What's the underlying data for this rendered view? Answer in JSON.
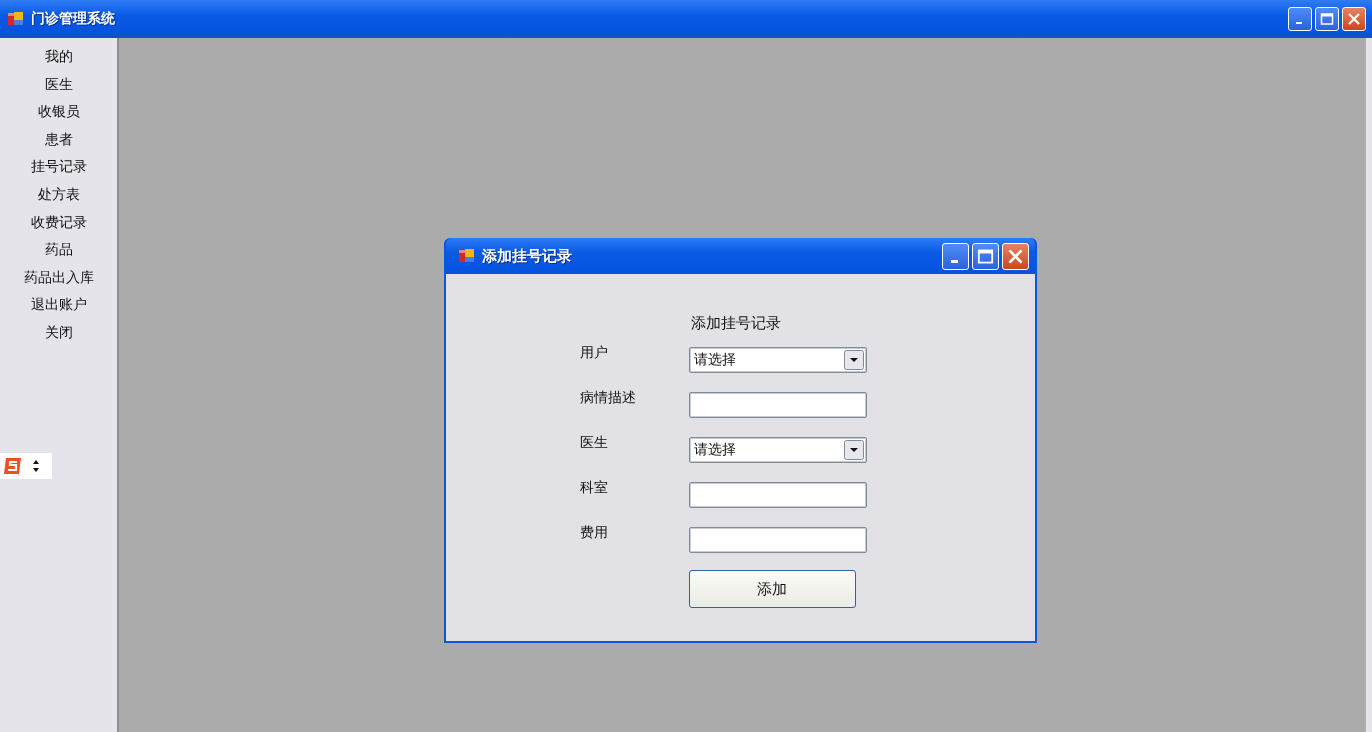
{
  "window": {
    "title": "门诊管理系统"
  },
  "sidebar": {
    "items": [
      {
        "label": "我的"
      },
      {
        "label": "医生"
      },
      {
        "label": "收银员"
      },
      {
        "label": "患者"
      },
      {
        "label": "挂号记录"
      },
      {
        "label": "处方表"
      },
      {
        "label": "收费记录"
      },
      {
        "label": "药品"
      },
      {
        "label": "药品出入库"
      },
      {
        "label": "退出账户"
      },
      {
        "label": "关闭"
      }
    ]
  },
  "dialog": {
    "title": "添加挂号记录",
    "heading": "添加挂号记录",
    "fields": [
      {
        "label": "用户",
        "kind": "select",
        "value": "请选择"
      },
      {
        "label": "病情描述",
        "kind": "text"
      },
      {
        "label": "医生",
        "kind": "select",
        "value": "请选择"
      },
      {
        "label": "科室",
        "kind": "text"
      },
      {
        "label": "费用",
        "kind": "text"
      }
    ],
    "button": "添加"
  }
}
